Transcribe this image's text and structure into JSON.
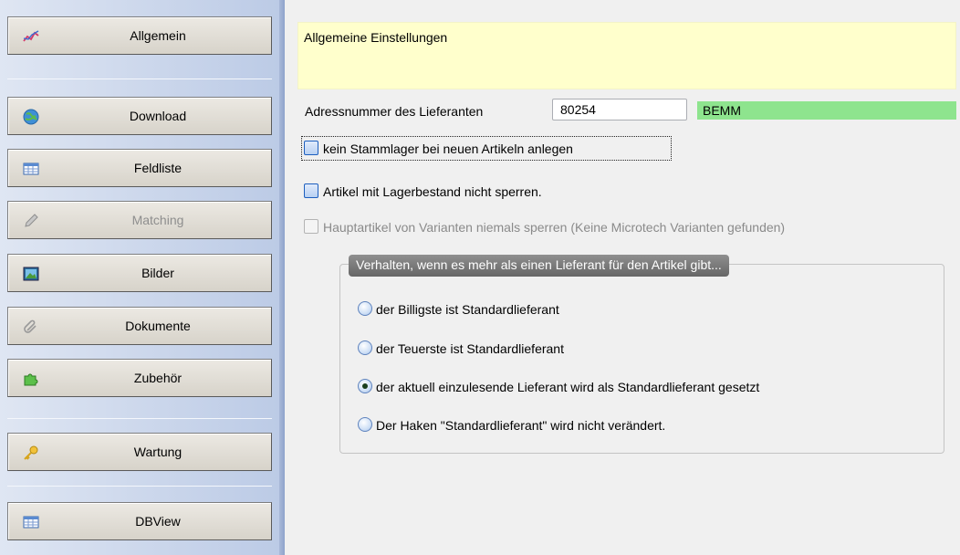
{
  "sidebar": {
    "items": [
      {
        "label": "Allgemein",
        "icon": "chart-line-icon",
        "disabled": false
      },
      {
        "label": "Download",
        "icon": "globe-icon",
        "disabled": false
      },
      {
        "label": "Feldliste",
        "icon": "table-icon",
        "disabled": false
      },
      {
        "label": "Matching",
        "icon": "pencil-icon",
        "disabled": true
      },
      {
        "label": "Bilder",
        "icon": "picture-icon",
        "disabled": false
      },
      {
        "label": "Dokumente",
        "icon": "paperclip-icon",
        "disabled": false
      },
      {
        "label": "Zubehör",
        "icon": "puzzle-icon",
        "disabled": false
      },
      {
        "label": "Wartung",
        "icon": "key-icon",
        "disabled": false
      },
      {
        "label": "DBView",
        "icon": "table-icon",
        "disabled": false
      }
    ]
  },
  "header": {
    "title": "Allgemeine Einstellungen",
    "color": "#ffffcc"
  },
  "supplier": {
    "label": "Adressnummer des Lieferanten",
    "number": "80254",
    "name": "BEMM",
    "name_color": "#8ee48e"
  },
  "options": {
    "no_main_stock": {
      "label": "kein Stammlager bei neuen Artikeln anlegen",
      "checked": false
    },
    "no_lock_stock": {
      "label": "Artikel mit Lagerbestand nicht sperren.",
      "checked": false
    },
    "no_lock_main_variant": {
      "label": "Hauptartikel von Varianten niemals sperren (Keine Microtech Varianten gefunden)",
      "checked": false,
      "disabled": true
    }
  },
  "supplier_behavior": {
    "title": "Verhalten, wenn es mehr als einen Lieferant für den Artikel gibt...",
    "choices": [
      {
        "label": "der Billigste ist Standardlieferant",
        "checked": false
      },
      {
        "label": "der Teuerste ist Standardlieferant",
        "checked": false
      },
      {
        "label": "der aktuell einzulesende Lieferant wird als Standardlieferant gesetzt",
        "checked": true
      },
      {
        "label": "Der Haken \"Standardlieferant\" wird nicht verändert.",
        "checked": false
      }
    ]
  }
}
